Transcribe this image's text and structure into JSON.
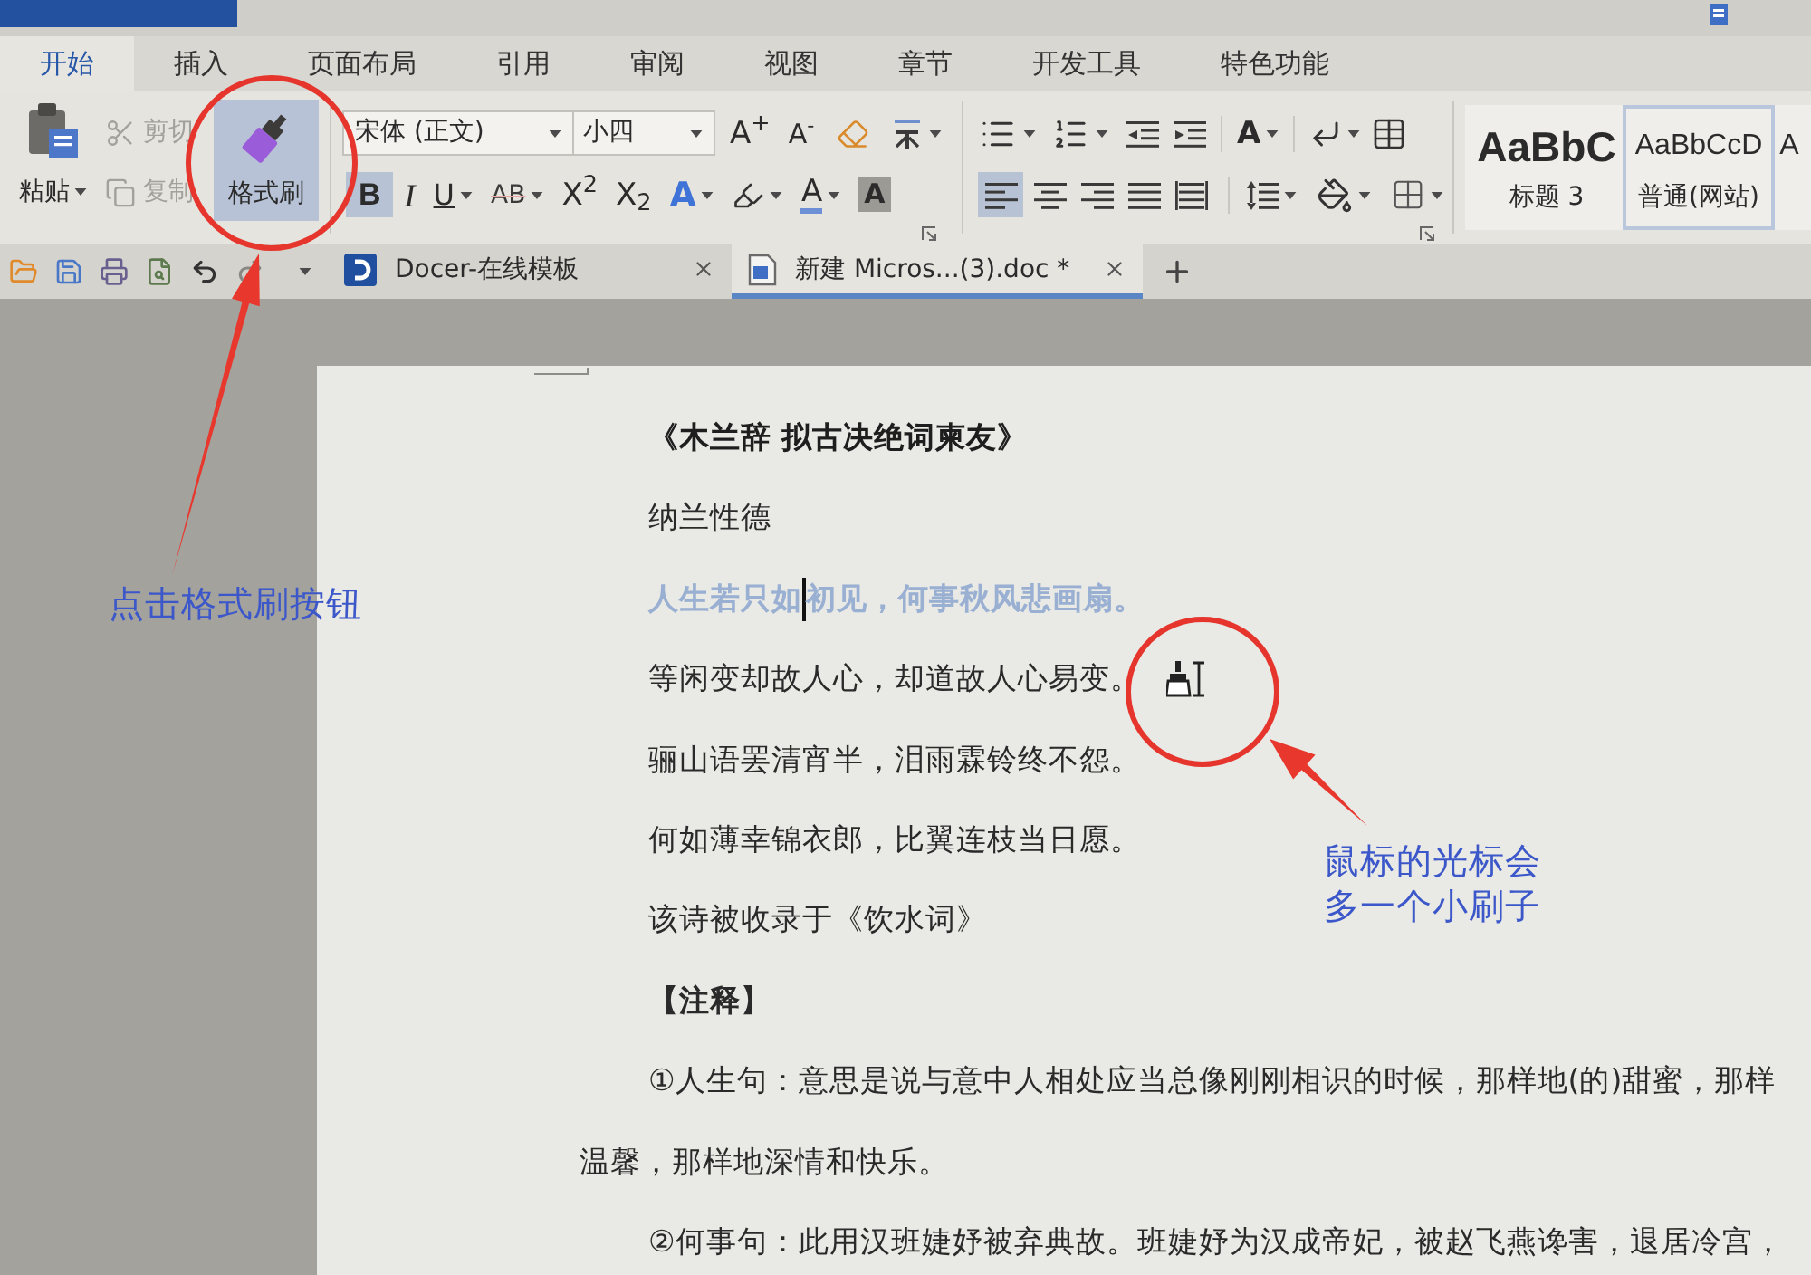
{
  "menu_tabs": [
    {
      "label": "开始",
      "selected": true
    },
    {
      "label": "插入",
      "selected": false
    },
    {
      "label": "页面布局",
      "selected": false
    },
    {
      "label": "引用",
      "selected": false
    },
    {
      "label": "审阅",
      "selected": false
    },
    {
      "label": "视图",
      "selected": false
    },
    {
      "label": "章节",
      "selected": false
    },
    {
      "label": "开发工具",
      "selected": false
    },
    {
      "label": "特色功能",
      "selected": false
    }
  ],
  "clipboard": {
    "paste": "粘贴",
    "cut": {
      "label": "剪切",
      "disabled": true
    },
    "copy": {
      "label": "复制",
      "disabled": true
    },
    "format_painter": {
      "label": "格式刷",
      "active": true
    }
  },
  "font": {
    "name": "宋体 (正文)",
    "size": "小四",
    "grow": "A$^{+}$",
    "shrink": "A$^{-}$",
    "styles": [
      {
        "kind": "bold",
        "label": "B",
        "selected": true
      },
      {
        "kind": "italic",
        "label": "I",
        "selected": false
      },
      {
        "kind": "underline",
        "label": "U",
        "selected": false
      },
      {
        "kind": "strikethrough",
        "label": "AB",
        "selected": false
      },
      {
        "kind": "superscript",
        "label": "X$^{2}$",
        "selected": false
      },
      {
        "kind": "subscript",
        "label": "X$_{2}$",
        "selected": false
      },
      {
        "kind": "effect",
        "label": "A",
        "selected": false
      },
      {
        "kind": "highlight",
        "selected": false
      },
      {
        "kind": "color",
        "label": "A",
        "selected": false
      },
      {
        "kind": "shading",
        "label": "A",
        "selected": false
      }
    ]
  },
  "paragraph": {
    "spacing_label": "A",
    "alignment": [
      {
        "kind": "left",
        "selected": true
      },
      {
        "kind": "center",
        "selected": false
      },
      {
        "kind": "right",
        "selected": false
      },
      {
        "kind": "justify",
        "selected": false
      },
      {
        "kind": "distributed",
        "selected": false
      }
    ]
  },
  "style_gallery": [
    {
      "kind": "heading",
      "preview": "AaBbC",
      "name": "标题 3",
      "selected": false
    },
    {
      "kind": "normal",
      "preview": "AaBbCcD",
      "name": "普通(网站)",
      "selected": true
    },
    {
      "kind": "partial",
      "preview": "A",
      "selected": false
    }
  ],
  "document_tabs": [
    {
      "kind": "docer",
      "label": "Docer-在线模板",
      "selected": false
    },
    {
      "kind": "document",
      "label": "新建 Micros...(3).doc *",
      "selected": true
    }
  ],
  "document": {
    "lines": [
      {
        "kind": "title",
        "text": "《木兰辞 拟古决绝词柬友》",
        "painter_cursor": false
      },
      {
        "kind": "body",
        "text": "纳兰性德",
        "painter_cursor": false
      },
      {
        "kind": "painted",
        "text_before_cursor": "人生若只如",
        "text_after_cursor": "初见，何事秋风悲画扇。",
        "painter_cursor": false
      },
      {
        "kind": "body",
        "text": "等闲变却故人心，却道故人心易变。",
        "painter_cursor": true
      },
      {
        "kind": "body",
        "text": "骊山语罢清宵半，泪雨霖铃终不怨。",
        "painter_cursor": false
      },
      {
        "kind": "body",
        "text": "何如薄幸锦衣郎，比翼连枝当日愿。",
        "painter_cursor": false
      },
      {
        "kind": "body",
        "text": "该诗被收录于《饮水词》",
        "painter_cursor": false
      },
      {
        "kind": "heading",
        "text": "【注释】",
        "painter_cursor": false
      },
      {
        "kind": "body",
        "text": "①人生句：意思是说与意中人相处应当总像刚刚相识的时候，那样地(的)甜蜜，那样",
        "painter_cursor": false
      },
      {
        "kind": "continuation",
        "text": "温馨，那样地深情和快乐。",
        "painter_cursor": false
      },
      {
        "kind": "body",
        "text": "②何事句：此用汉班婕妤被弃典故。班婕妤为汉成帝妃，被赵飞燕谗害，退居冷宫，",
        "painter_cursor": false
      }
    ]
  },
  "annotations": [
    {
      "kind": "button-callout",
      "lines": [
        "点击格式刷按钮"
      ]
    },
    {
      "kind": "cursor-callout",
      "lines": [
        "鼠标的光标会",
        "多一个小刷子"
      ]
    }
  ]
}
